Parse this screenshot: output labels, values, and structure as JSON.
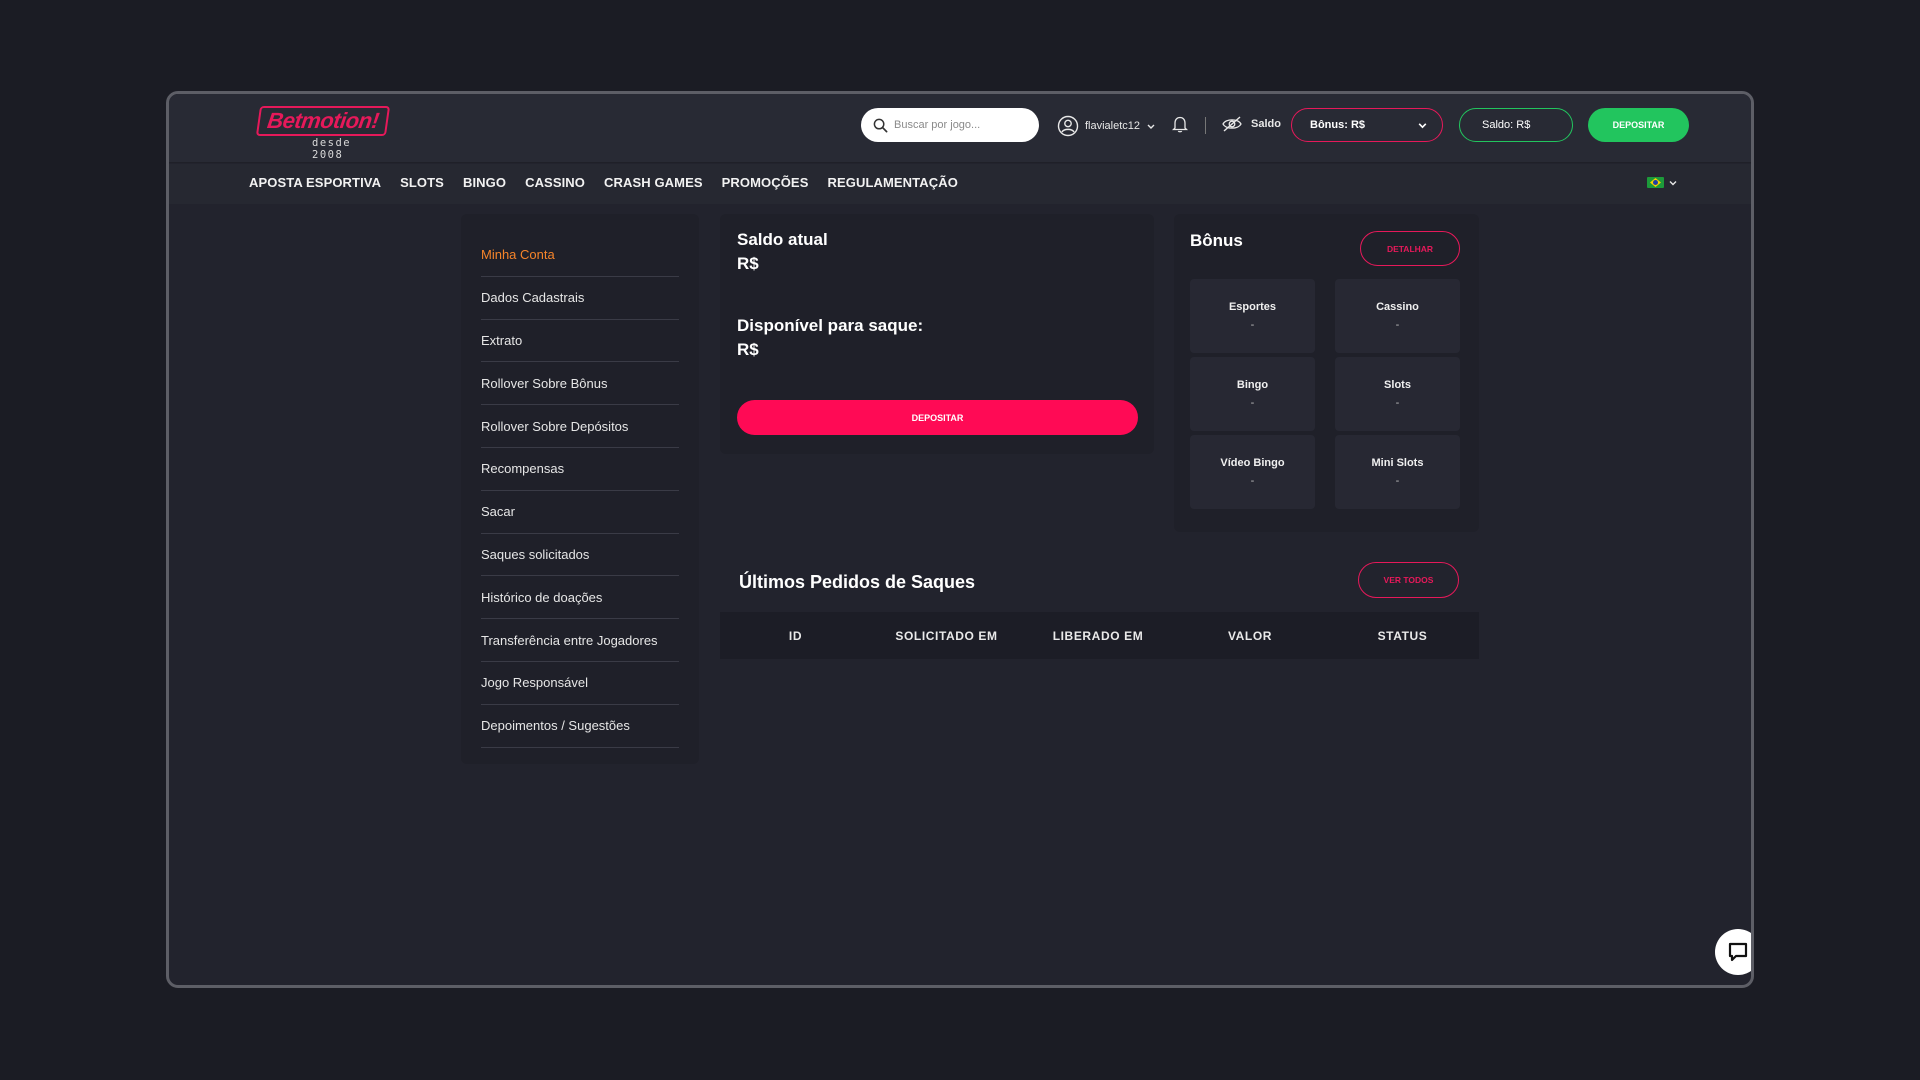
{
  "header": {
    "logo_text": "Betmotion!",
    "logo_subtitle": "desde 2008",
    "search_placeholder": "Buscar por jogo...",
    "username": "flavialetc12",
    "saldo_toggle_label": "Saldo",
    "bonus_select_label": "Bônus: R$",
    "saldo_pill_label": "Saldo: R$",
    "deposit_label": "DEPOSITAR"
  },
  "nav": {
    "items": [
      "APOSTA ESPORTIVA",
      "SLOTS",
      "BINGO",
      "CASSINO",
      "CRASH GAMES",
      "PROMOÇÕES",
      "REGULAMENTAÇÃO"
    ],
    "language": "pt-BR"
  },
  "sidebar": {
    "items": [
      {
        "label": "Minha Conta",
        "active": true
      },
      {
        "label": "Dados Cadastrais"
      },
      {
        "label": "Extrato"
      },
      {
        "label": "Rollover Sobre Bônus"
      },
      {
        "label": "Rollover Sobre Depósitos"
      },
      {
        "label": "Recompensas"
      },
      {
        "label": "Sacar"
      },
      {
        "label": "Saques solicitados"
      },
      {
        "label": "Histórico de doações"
      },
      {
        "label": "Transferência entre Jogadores"
      },
      {
        "label": "Jogo Responsável"
      },
      {
        "label": "Depoimentos / Sugestões"
      }
    ]
  },
  "balance": {
    "current_label": "Saldo atual",
    "current_value": "R$",
    "available_label": "Disponível para saque:",
    "available_value": "R$",
    "deposit_label": "DEPOSITAR"
  },
  "bonus": {
    "title": "Bônus",
    "detail_label": "DETALHAR",
    "tiles": [
      {
        "label": "Esportes",
        "value": "-"
      },
      {
        "label": "Cassino",
        "value": "-"
      },
      {
        "label": "Bingo",
        "value": "-"
      },
      {
        "label": "Slots",
        "value": "-"
      },
      {
        "label": "Vídeo Bingo",
        "value": "-"
      },
      {
        "label": "Mini Slots",
        "value": "-"
      }
    ]
  },
  "withdrawals": {
    "title": "Últimos Pedidos de Saques",
    "view_all_label": "VER TODOS",
    "columns": [
      "ID",
      "SOLICITADO EM",
      "LIBERADO EM",
      "VALOR",
      "STATUS"
    ],
    "rows": []
  },
  "colors": {
    "accent_pink": "#e6195a",
    "accent_green": "#22c55e",
    "active_menu_orange": "#f5842a"
  }
}
